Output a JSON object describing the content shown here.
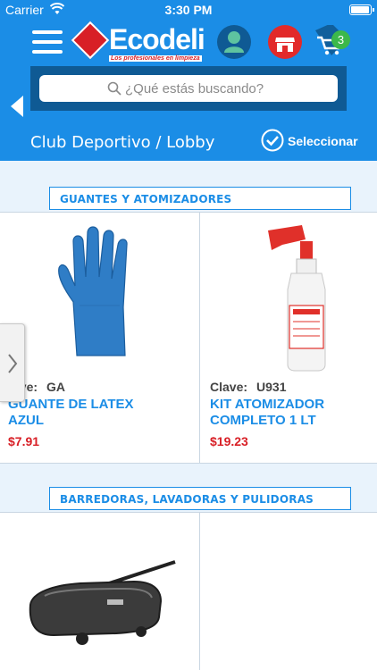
{
  "status": {
    "carrier": "Carrier",
    "time": "3:30 PM",
    "battery_level": 1.0
  },
  "header": {
    "brand": "Ecodeli",
    "tagline": "Los profesionales en limpieza",
    "cart_count": "3",
    "search_placeholder": "¿Qué estás buscando?",
    "location": "Club Deportivo / Lobby",
    "select_label": "Seleccionar",
    "colors": {
      "primary": "#1b8de6",
      "dark": "#0f5a94",
      "red": "#d81f26",
      "green": "#3cb84a"
    }
  },
  "categories": [
    {
      "title": "GUANTES Y ATOMIZADORES",
      "products": [
        {
          "clave_label": "Clave:",
          "clave": "GA",
          "name": "GUANTE DE LATEX AZUL",
          "price": "$7.91",
          "icon": "blue-latex-glove"
        },
        {
          "clave_label": "Clave:",
          "clave": "U931",
          "name": "KIT ATOMIZADOR COMPLETO 1 LT",
          "price": "$19.23",
          "icon": "spray-bottle"
        }
      ]
    },
    {
      "title": "BARREDORAS, LAVADORAS Y PULIDORAS",
      "products": [
        {
          "icon": "carpet-sweeper"
        },
        {
          "icon": "empty"
        }
      ]
    }
  ]
}
